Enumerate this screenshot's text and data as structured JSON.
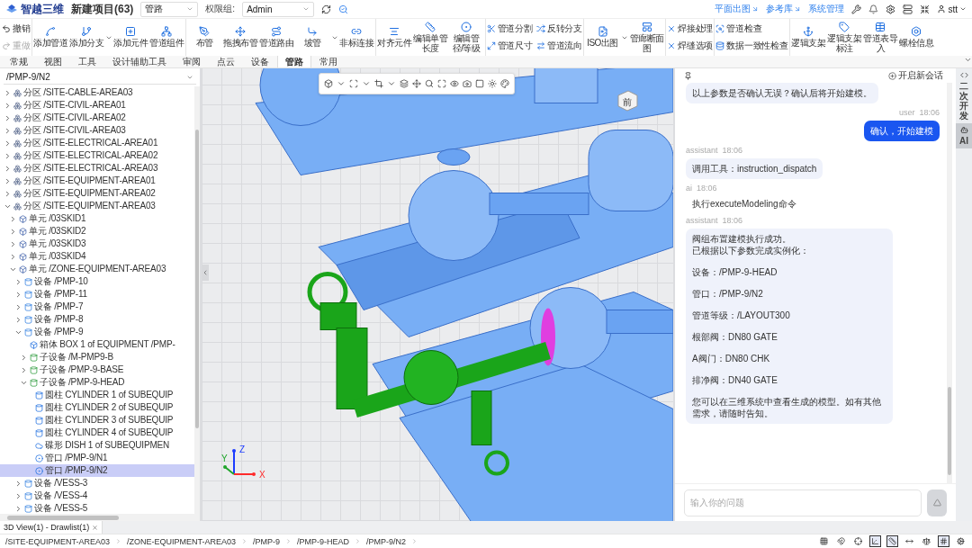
{
  "top_bar": {
    "logo": "智越三维",
    "project": "新建项目(63)",
    "discipline_select": "管路",
    "permission_label": "权限组:",
    "permission_select": "Admin",
    "links": [
      "平面出图",
      "参考库",
      "系统管理"
    ],
    "user": "stt"
  },
  "ribbon": {
    "groups": [
      {
        "items": [
          {
            "label": "撤销",
            "kind": "small",
            "disabled": false
          },
          {
            "label": "重做",
            "kind": "small",
            "disabled": true
          }
        ]
      },
      {
        "items": [
          {
            "label": "添加管道",
            "kind": "large"
          },
          {
            "label": "添加分支",
            "kind": "split"
          },
          {
            "label": "添加元件",
            "kind": "large"
          },
          {
            "label": "管道组件",
            "kind": "large"
          }
        ]
      },
      {
        "items": [
          {
            "label": "布管",
            "kind": "large"
          },
          {
            "label": "拖拽布管",
            "kind": "large"
          },
          {
            "label": "管道路由",
            "kind": "large"
          },
          {
            "label": "坡管",
            "kind": "split"
          },
          {
            "label": "非标连接",
            "kind": "large"
          }
        ]
      },
      {
        "items": [
          {
            "label": "对齐元件",
            "kind": "large"
          },
          {
            "label": "编辑单管长度",
            "kind": "large"
          },
          {
            "label": "编辑管径/等级",
            "kind": "large"
          }
        ]
      },
      {
        "items": [
          {
            "label": "管道分割",
            "kind": "small"
          },
          {
            "label": "管道尺寸",
            "kind": "small"
          },
          {
            "label": "反转分支",
            "kind": "small"
          },
          {
            "label": "管道流向",
            "kind": "small"
          }
        ]
      },
      {
        "items": [
          {
            "label": "ISO出图",
            "kind": "split"
          },
          {
            "label": "管廊断面图",
            "kind": "large"
          }
        ]
      },
      {
        "items": [
          {
            "label": "焊接处理",
            "kind": "small"
          },
          {
            "label": "焊缝选项",
            "kind": "small"
          }
        ]
      },
      {
        "items": [
          {
            "label": "管道检查",
            "kind": "small"
          },
          {
            "label": "数据一致性检查",
            "kind": "small"
          }
        ]
      },
      {
        "items": [
          {
            "label": "逻辑支架",
            "kind": "large"
          },
          {
            "label": "逻辑支架标注",
            "kind": "large"
          },
          {
            "label": "管道表导入",
            "kind": "large"
          },
          {
            "label": "螺栓信息",
            "kind": "large"
          }
        ]
      }
    ]
  },
  "ribbon_tabs": [
    {
      "label": "常规",
      "selected": false
    },
    {
      "label": "视图",
      "selected": false
    },
    {
      "label": "工具",
      "selected": false
    },
    {
      "label": "设计辅助工具",
      "selected": false
    },
    {
      "label": "审阅",
      "selected": false
    },
    {
      "label": "点云",
      "selected": false
    },
    {
      "label": "设备",
      "selected": false
    },
    {
      "label": "管路",
      "selected": true
    },
    {
      "label": "常用",
      "selected": false
    }
  ],
  "tree_panel": {
    "path_select": "/PMP-9/N2",
    "nodes": [
      {
        "label": "分区 /SITE-CABLE-AREA03",
        "kind": "zone",
        "expanded": false,
        "selected": false
      },
      {
        "label": "分区 /SITE-CIVIL-AREA01",
        "kind": "zone",
        "expanded": false,
        "selected": false
      },
      {
        "label": "分区 /SITE-CIVIL-AREA02",
        "kind": "zone",
        "expanded": false,
        "selected": false
      },
      {
        "label": "分区 /SITE-CIVIL-AREA03",
        "kind": "zone",
        "expanded": false,
        "selected": false
      },
      {
        "label": "分区 /SITE-ELECTRICAL-AREA01",
        "kind": "zone",
        "expanded": false,
        "selected": false
      },
      {
        "label": "分区 /SITE-ELECTRICAL-AREA02",
        "kind": "zone",
        "expanded": false,
        "selected": false
      },
      {
        "label": "分区 /SITE-ELECTRICAL-AREA03",
        "kind": "zone",
        "expanded": false,
        "selected": false
      },
      {
        "label": "分区 /SITE-EQUIPMENT-AREA01",
        "kind": "zone",
        "expanded": false,
        "selected": false
      },
      {
        "label": "分区 /SITE-EQUIPMENT-AREA02",
        "kind": "zone",
        "expanded": false,
        "selected": false
      },
      {
        "label": "分区 /SITE-EQUIPMENT-AREA03",
        "kind": "zone",
        "expanded": true,
        "selected": false,
        "children": [
          {
            "label": "单元 /03SKID1",
            "kind": "unit",
            "expanded": false,
            "selected": false
          },
          {
            "label": "单元 /03SKID2",
            "kind": "unit",
            "expanded": false,
            "selected": false
          },
          {
            "label": "单元 /03SKID3",
            "kind": "unit",
            "expanded": false,
            "selected": false
          },
          {
            "label": "单元 /03SKID4",
            "kind": "unit",
            "expanded": false,
            "selected": false
          },
          {
            "label": "单元 /ZONE-EQUIPMENT-AREA03",
            "kind": "unit",
            "expanded": true,
            "selected": false,
            "children": [
              {
                "label": "设备 /PMP-10",
                "kind": "equipment",
                "expanded": false,
                "selected": false
              },
              {
                "label": "设备 /PMP-11",
                "kind": "equipment",
                "expanded": false,
                "selected": false
              },
              {
                "label": "设备 /PMP-7",
                "kind": "equipment",
                "expanded": false,
                "selected": false
              },
              {
                "label": "设备 /PMP-8",
                "kind": "equipment",
                "expanded": false,
                "selected": false
              },
              {
                "label": "设备 /PMP-9",
                "kind": "equipment",
                "expanded": true,
                "selected": false,
                "children": [
                  {
                    "label": "箱体 BOX 1 of EQUIPMENT /PMP-",
                    "kind": "box",
                    "selected": false
                  },
                  {
                    "label": "子设备 /M-PMP9-B",
                    "kind": "subequipment",
                    "expanded": false,
                    "selected": false
                  },
                  {
                    "label": "子设备 /PMP-9-BASE",
                    "kind": "subequipment",
                    "expanded": false,
                    "selected": false
                  },
                  {
                    "label": "子设备 /PMP-9-HEAD",
                    "kind": "subequipment",
                    "expanded": true,
                    "selected": false,
                    "children": [
                      {
                        "label": "圆柱 CYLINDER 1 of SUBEQUIP",
                        "kind": "cylinder",
                        "selected": false
                      },
                      {
                        "label": "圆柱 CYLINDER 2 of SUBEQUIP",
                        "kind": "cylinder",
                        "selected": false
                      },
                      {
                        "label": "圆柱 CYLINDER 3 of SUBEQUIP",
                        "kind": "cylinder",
                        "selected": false
                      },
                      {
                        "label": "圆柱 CYLINDER 4 of SUBEQUIP",
                        "kind": "cylinder",
                        "selected": false
                      },
                      {
                        "label": "碟形 DISH 1 of SUBEQUIPMEN",
                        "kind": "dish",
                        "selected": false
                      },
                      {
                        "label": "管口 /PMP-9/N1",
                        "kind": "nozzle",
                        "selected": false
                      },
                      {
                        "label": "管口 /PMP-9/N2",
                        "kind": "nozzle",
                        "selected": true
                      }
                    ]
                  }
                ]
              },
              {
                "label": "设备 /VESS-3",
                "kind": "equipment",
                "expanded": false,
                "selected": false
              },
              {
                "label": "设备 /VESS-4",
                "kind": "equipment",
                "expanded": false,
                "selected": false
              },
              {
                "label": "设备 /VESS-5",
                "kind": "equipment",
                "expanded": false,
                "selected": false
              }
            ]
          }
        ]
      }
    ]
  },
  "viewport": {
    "view_cube": "前",
    "axes": [
      {
        "label": "Z",
        "color": "#1d3cff"
      },
      {
        "label": "Y",
        "color": "#1fa52b"
      },
      {
        "label": "X",
        "color": "#ff2b2b"
      }
    ]
  },
  "chat": {
    "new_session": "开启新会话",
    "messages": [
      {
        "kind": "bubble",
        "paragraphs": [
          [
            "以上参数是否确认无误？确认后将开始建模。"
          ]
        ]
      },
      {
        "kind": "user",
        "role": "user",
        "time": "18:06",
        "paragraphs": [
          [
            "确认，开始建模"
          ]
        ]
      },
      {
        "kind": "bubble",
        "role": "assistant",
        "time": "18:06",
        "paragraphs": [
          [
            "调用工具：instruction_dispatch"
          ]
        ]
      },
      {
        "kind": "plain",
        "role": "ai",
        "time": "18:06",
        "paragraphs": [
          [
            "执行executeModeling命令"
          ]
        ]
      },
      {
        "kind": "bubble",
        "role": "assistant",
        "time": "18:06",
        "paragraphs": [
          [
            "阀组布置建模执行成功。",
            "已根据以下参数完成实例化："
          ],
          [
            "设备：/PMP-9-HEAD"
          ],
          [
            "管口：/PMP-9/N2"
          ],
          [
            "管道等级：/LAYOUT300"
          ],
          [
            "根部阀：DN80 GATE"
          ],
          [
            "A阀门：DN80 CHK"
          ],
          [
            "排净阀：DN40 GATE"
          ],
          [
            "您可以在三维系统中查看生成的模型。如有其他需求，请随时告知。"
          ]
        ]
      }
    ],
    "input": {
      "placeholder": "输入你的问题",
      "send_disabled": true
    }
  },
  "side_tabs": [
    {
      "label": "二次开发",
      "selected": false
    },
    {
      "label": "AI",
      "selected": true
    }
  ],
  "document_tabs": [
    {
      "label": "3D View(1) - Drawlist(1)",
      "selected": true
    }
  ],
  "breadcrumb": [
    "/SITE-EQUIPMENT-AREA03",
    "/ZONE-EQUIPMENT-AREA03",
    "/PMP-9",
    "/PMP-9-HEAD",
    "/PMP-9/N2"
  ]
}
